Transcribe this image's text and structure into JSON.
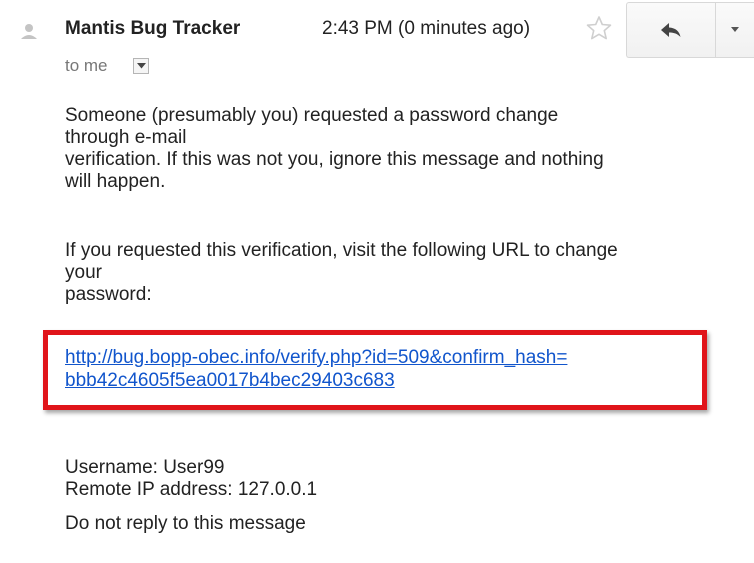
{
  "header": {
    "sender_name": "Mantis Bug Tracker",
    "timestamp": "2:43 PM (0 minutes ago)",
    "recipient_label": "to me",
    "avatar_icon": "person-icon",
    "star_icon": "star-outline-icon",
    "reply_icon": "reply-arrow-icon",
    "more_icon": "chevron-down-icon"
  },
  "body": {
    "paragraph_1": "Someone (presumably you) requested a password change\nthrough e-mail\nverification. If this was not you, ignore this message and nothing\nwill happen.",
    "paragraph_2": "If you requested this verification, visit the following URL to change\nyour\npassword:",
    "verify_link": "http://bug.bopp-obec.info/verify.php?id=509&confirm_hash=\nbbb42c4605f5ea0017b4bec29403c683",
    "account_info": "Username: User99\nRemote IP address: 127.0.0.1",
    "footer_note": "Do not reply to this message"
  },
  "colors": {
    "link": "#1155cc",
    "highlight_border": "#e0141a",
    "muted_text": "#777777",
    "body_text": "#222222"
  }
}
